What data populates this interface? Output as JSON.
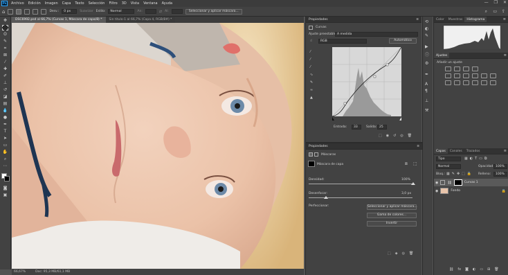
{
  "menu": {
    "app_badge": "Ps",
    "items": [
      "Archivo",
      "Edición",
      "Imagen",
      "Capa",
      "Texto",
      "Selección",
      "Filtro",
      "3D",
      "Vista",
      "Ventana",
      "Ayuda"
    ]
  },
  "options_bar": {
    "desvan_label": "Desv.:",
    "desvan_value": "0 px",
    "suavizar_label": "Suavizar",
    "estilo_label": "Estilo:",
    "estilo_value": "Normal",
    "an_label": "An:",
    "al_label": "Al:",
    "select_mask_button": "Seleccionar y aplicar máscara..."
  },
  "tabs": [
    {
      "label": "DSC6992.psd al 66,7% (Curvas 1, Máscara de capa/8) *",
      "active": true
    },
    {
      "label": "Sin título-1 al 66,7% (Capa 4, RGB/8#) *",
      "active": false
    }
  ],
  "status": {
    "zoom": "66,67%",
    "doc": "Doc: 95,3 MB/61,1 MB"
  },
  "curves_panel": {
    "panel_title": "Propiedades",
    "header": "Curvas",
    "preset_label": "Ajuste preestablecido:",
    "preset_value": "A medida",
    "channel_value": "RGB",
    "auto_button": "Automático",
    "input_label": "Entrada:",
    "input_value": "33",
    "output_label": "Salida:",
    "output_value": "25"
  },
  "mask_panel": {
    "panel_title": "Propiedades",
    "header": "Máscaras",
    "mask_label": "Máscara de capa",
    "density_label": "Densidad:",
    "density_value": "100%",
    "feather_label": "Desenfocar:",
    "feather_value": "3,0 px",
    "refine_label": "Perfeccionar:",
    "select_mask_button": "Seleccionar y aplicar máscara...",
    "color_range_button": "Gama de colores...",
    "invert_button": "Invertir"
  },
  "right_top": {
    "tabs": [
      "Color",
      "Muestras",
      "Histograma"
    ]
  },
  "adjustments": {
    "tab": "Ajustes",
    "hint": "Añadir un ajuste"
  },
  "layers": {
    "tabs": [
      "Capas",
      "Canales",
      "Trazados"
    ],
    "filter_value": "Tipo",
    "blend_value": "Normal",
    "opacity_label": "Opacidad:",
    "opacity_value": "100%",
    "lock_label": "Bloq.:",
    "fill_label": "Relleno:",
    "fill_value": "100%",
    "items": [
      {
        "name": "Curvas 1"
      },
      {
        "name": "Fondo"
      }
    ]
  },
  "colors": {
    "accent": "#31a8ff"
  }
}
